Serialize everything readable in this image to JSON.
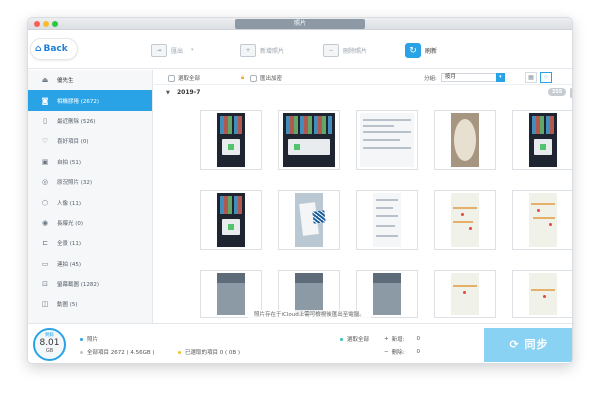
{
  "window": {
    "title": "照片"
  },
  "toolbar": {
    "back": "Back",
    "export": "匯出",
    "add": "新增照片",
    "delete": "刪除照片",
    "refresh": "刷新"
  },
  "sidebar": {
    "items": [
      {
        "label": "優先生",
        "icon": "person-icon"
      },
      {
        "label": "相機膠捲 (2672)",
        "icon": "camera-icon"
      },
      {
        "label": "最近刪除 (526)",
        "icon": "trash-icon"
      },
      {
        "label": "喜好項目 (0)",
        "icon": "heart-icon"
      },
      {
        "label": "自拍 (51)",
        "icon": "selfie-icon"
      },
      {
        "label": "原況照片 (32)",
        "icon": "live-photo-icon"
      },
      {
        "label": "人像 (11)",
        "icon": "cube-icon"
      },
      {
        "label": "長曝光 (0)",
        "icon": "long-exposure-icon"
      },
      {
        "label": "全景 (11)",
        "icon": "panorama-icon"
      },
      {
        "label": "連拍 (45)",
        "icon": "burst-icon"
      },
      {
        "label": "螢幕截圖 (1282)",
        "icon": "screenshot-icon"
      },
      {
        "label": "動圖 (5)",
        "icon": "animated-icon"
      }
    ]
  },
  "filter": {
    "select_all": "選取全部",
    "export_encrypted": "匯出加密",
    "category_label": "分組:",
    "category_value": "按月"
  },
  "date_group": {
    "label": "2019-7",
    "count": "355"
  },
  "notice": "照片存在于iCloud上需可檢視後匯出至電腦。",
  "bottom": {
    "gauge_label": "剩餘",
    "gauge_value": "8.01",
    "gauge_unit": "GB",
    "photos_label": "照片",
    "all_items": "全部項目 2672 ( 4.56GB )",
    "selected_items": "已選取的項目 0 ( 0B )",
    "select_all": "選取全部",
    "add_label": "新增:",
    "add_value": "0",
    "delete_label": "刪除:",
    "delete_value": "0",
    "sync": "同步"
  },
  "colors": {
    "accent": "#29a3e6",
    "sync": "#8ad2f3",
    "lock": "#f0a81c"
  }
}
